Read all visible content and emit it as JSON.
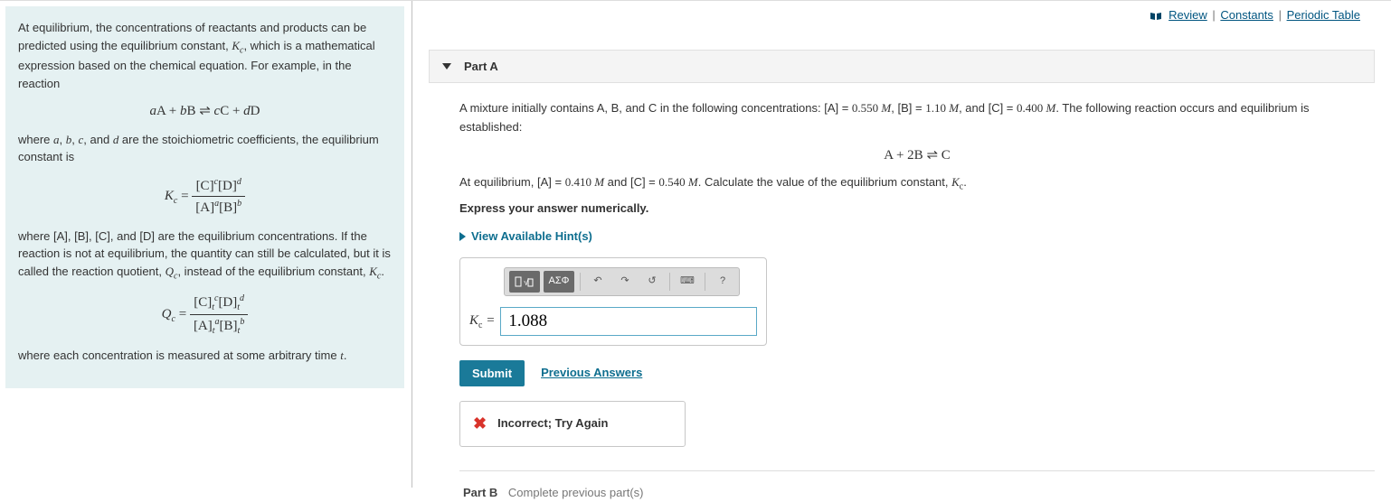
{
  "topLinks": {
    "review": "Review",
    "constants": "Constants",
    "periodic": "Periodic Table"
  },
  "intro": {
    "p1_a": "At equilibrium, the concentrations of reactants and products can be predicted using the equilibrium constant, ",
    "p1_kc": "K",
    "p1_kcsub": "c",
    "p1_b": ", which is a mathematical expression based on the chemical equation. For example, in the reaction",
    "eq1_html": "aA + bB ⇌ cC + dD",
    "p2_a": "where ",
    "p2_b": ", ",
    "p2_c": ", ",
    "p2_d": ", and ",
    "p2_e": " are the stoichiometric coefficients, the equilibrium constant is",
    "coef_a": "a",
    "coef_b": "b",
    "coef_c": "c",
    "coef_d": "d",
    "kc_eq_lhs": "K",
    "kc_eq_sub": "c",
    "kc_num": "[C]ᶜ[D]ᵈ",
    "kc_den": "[A]ᵃ[B]ᵇ",
    "p3": "where [A], [B], [C], and [D] are the equilibrium concentrations. If the reaction is not at equilibrium, the quantity can still be calculated, but it is called the reaction quotient, ",
    "qc": "Q",
    "qcsub": "c",
    "p3_b": ", instead of the equilibrium constant, ",
    "p3_c": ".",
    "qc_eq_lhs": "Q",
    "qc_num_html": "[C]ₜᶜ[D]ₜᵈ",
    "qc_den_html": "[A]ₜᵃ[B]ₜᵇ",
    "p4_a": "where each concentration is measured at some arbitrary time ",
    "p4_t": "t",
    "p4_b": "."
  },
  "partA": {
    "header": "Part A",
    "body1_a": "A mixture initially contains A, B, and C in the following concentrations: [A] = ",
    "a0": "0.550",
    "unitM": " M",
    "sep": ", ",
    "body1_b": "[B] = ",
    "b0": "1.10",
    "body1_c": ", and [C] = ",
    "c0": "0.400",
    "body1_d": ". The following reaction occurs and equilibrium is established:",
    "rxn": "A + 2B ⇌ C",
    "body2_a": "At equilibrium, [A] = ",
    "aEq": "0.410",
    "body2_b": " and [C] = ",
    "cEq": "0.540",
    "body2_c": ". Calculate the value of the equilibrium constant, ",
    "body2_d": ".",
    "instruction": "Express your answer numerically.",
    "hints": "View Available Hint(s)",
    "kcLabel": "Kc =",
    "answerValue": "1.088",
    "submit": "Submit",
    "prevAnswers": "Previous Answers",
    "feedback": "Incorrect; Try Again",
    "toolbar": {
      "fraction": "▯√▯",
      "greek": "ΑΣΦ",
      "undo": "↶",
      "redo": "↷",
      "reset": "↺",
      "keyboard": "⌨",
      "help": "?"
    }
  },
  "partB": {
    "label": "Part B",
    "msg": "Complete previous part(s)"
  }
}
